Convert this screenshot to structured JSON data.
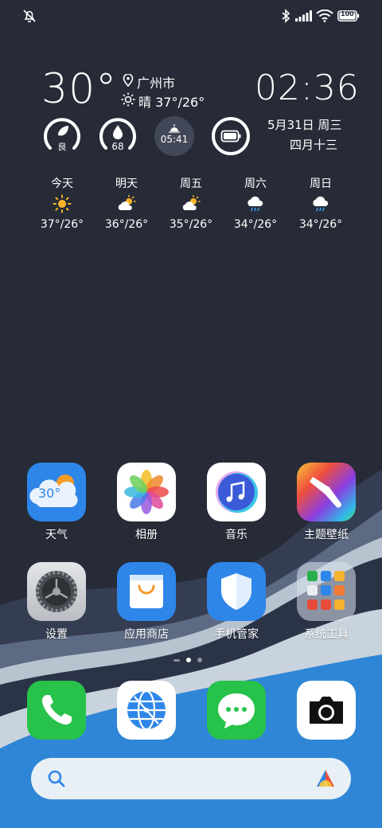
{
  "status_bar": {
    "icons": [
      "mute-bell-icon",
      "bluetooth-icon",
      "signal-icon",
      "wifi-icon",
      "battery-icon"
    ],
    "battery_text": "100"
  },
  "weather_widget": {
    "temperature": "30°",
    "city": "广州市",
    "condition": "晴 37°/26°",
    "time": "02:36",
    "date": "5月31日 周三",
    "lunar_date": "四月十三",
    "air_quality": "良",
    "humidity": "68",
    "sunrise": "05:41",
    "forecast": [
      {
        "day": "今天",
        "icon": "sunny-icon",
        "range": "37°/26°"
      },
      {
        "day": "明天",
        "icon": "partly-cloudy-icon",
        "range": "36°/26°"
      },
      {
        "day": "周五",
        "icon": "partly-cloudy-icon",
        "range": "35°/26°"
      },
      {
        "day": "周六",
        "icon": "rain-icon",
        "range": "34°/26°"
      },
      {
        "day": "周日",
        "icon": "rain-icon",
        "range": "34°/26°"
      }
    ]
  },
  "apps": {
    "weather": {
      "label": "天气",
      "badge": "30°"
    },
    "gallery": {
      "label": "相册"
    },
    "music": {
      "label": "音乐"
    },
    "themes": {
      "label": "主题壁纸"
    },
    "settings": {
      "label": "设置"
    },
    "app_store": {
      "label": "应用商店"
    },
    "phone_manager": {
      "label": "手机管家"
    },
    "system_tools": {
      "label": "系统工具"
    }
  },
  "page_indicator": {
    "pages": 3,
    "current": 2
  },
  "dock": [
    "phone",
    "browser",
    "messages",
    "camera"
  ],
  "search": {
    "icon": "search-icon",
    "assistant_icon": "assistant-logo-icon"
  },
  "colors": {
    "background": "#262b37",
    "wave_blue": "#2f86d6",
    "wave_slate": "#3a4358",
    "search_bg": "#e8f0f6"
  }
}
